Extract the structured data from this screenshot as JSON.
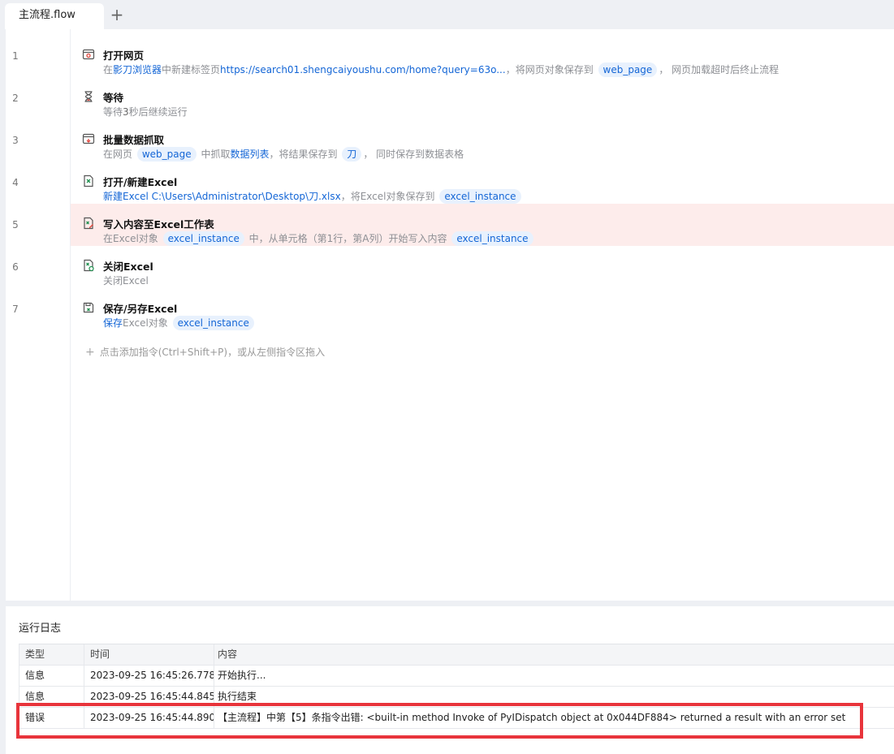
{
  "tabs": [
    {
      "label": "主流程.flow"
    }
  ],
  "tab_add_label": "+",
  "steps": [
    {
      "line": "1",
      "icon": "browser-open-icon",
      "title": "打开网页",
      "desc": [
        {
          "t": "在"
        },
        {
          "t": "影刀浏览器",
          "k": "link"
        },
        {
          "t": "中新建标签页"
        },
        {
          "t": "https://search01.shengcaiyoushu.com/home?query=63o...",
          "k": "link"
        },
        {
          "t": "，将网页对象保存到 "
        },
        {
          "t": "web_page",
          "k": "tag"
        },
        {
          "t": "， 网页加载超时后终止流程"
        }
      ]
    },
    {
      "line": "2",
      "icon": "hourglass-icon",
      "title": "等待",
      "desc": [
        {
          "t": "等待"
        },
        {
          "t": "3",
          "k": "plain-dark"
        },
        {
          "t": "秒后继续运行"
        }
      ]
    },
    {
      "line": "3",
      "icon": "data-scrape-icon",
      "title": "批量数据抓取",
      "desc": [
        {
          "t": "在网页 "
        },
        {
          "t": "web_page",
          "k": "tag"
        },
        {
          "t": " 中抓取"
        },
        {
          "t": "数据列表",
          "k": "link"
        },
        {
          "t": "，将结果保存到 "
        },
        {
          "t": "刀",
          "k": "tag"
        },
        {
          "t": "， 同时保存到数据表格"
        }
      ]
    },
    {
      "line": "4",
      "icon": "excel-open-icon",
      "title": "打开/新建Excel",
      "desc": [
        {
          "t": "新建Excel C:\\Users\\Administrator\\Desktop\\刀.xlsx",
          "k": "link"
        },
        {
          "t": "，将Excel对象保存到 "
        },
        {
          "t": "excel_instance",
          "k": "tag"
        }
      ]
    },
    {
      "line": "5",
      "icon": "excel-write-icon",
      "title": "写入内容至Excel工作表",
      "error": true,
      "desc": [
        {
          "t": "在Excel对象 "
        },
        {
          "t": "excel_instance",
          "k": "tag"
        },
        {
          "t": " 中，从单元格（第1行，第A列）开始写入内容 "
        },
        {
          "t": "excel_instance",
          "k": "tag"
        }
      ]
    },
    {
      "line": "6",
      "icon": "excel-close-icon",
      "title": "关闭Excel",
      "desc": [
        {
          "t": "关闭Excel"
        }
      ]
    },
    {
      "line": "7",
      "icon": "excel-save-icon",
      "title": "保存/另存Excel",
      "desc": [
        {
          "t": "保存",
          "k": "link"
        },
        {
          "t": "Excel对象 "
        },
        {
          "t": "excel_instance",
          "k": "tag"
        }
      ]
    }
  ],
  "add_hint": "点击添加指令(Ctrl+Shift+P)，或从左侧指令区拖入",
  "log": {
    "title": "运行日志",
    "headers": {
      "type": "类型",
      "time": "时间",
      "msg": "内容"
    },
    "rows": [
      {
        "type": "信息",
        "time": "2023-09-25 16:45:26.778",
        "msg": "开始执行..."
      },
      {
        "type": "信息",
        "time": "2023-09-25 16:45:44.845",
        "msg": "执行结束"
      },
      {
        "type": "错误",
        "time": "2023-09-25 16:45:44.890",
        "msg": "【主流程】中第【5】条指令出错:  <built-in method Invoke of PyIDispatch object at 0x044DF884> returned a result with an error set"
      }
    ]
  },
  "colors": {
    "link": "#1466d6",
    "error_row": "#fdeceb",
    "highlight": "#e8343b"
  }
}
